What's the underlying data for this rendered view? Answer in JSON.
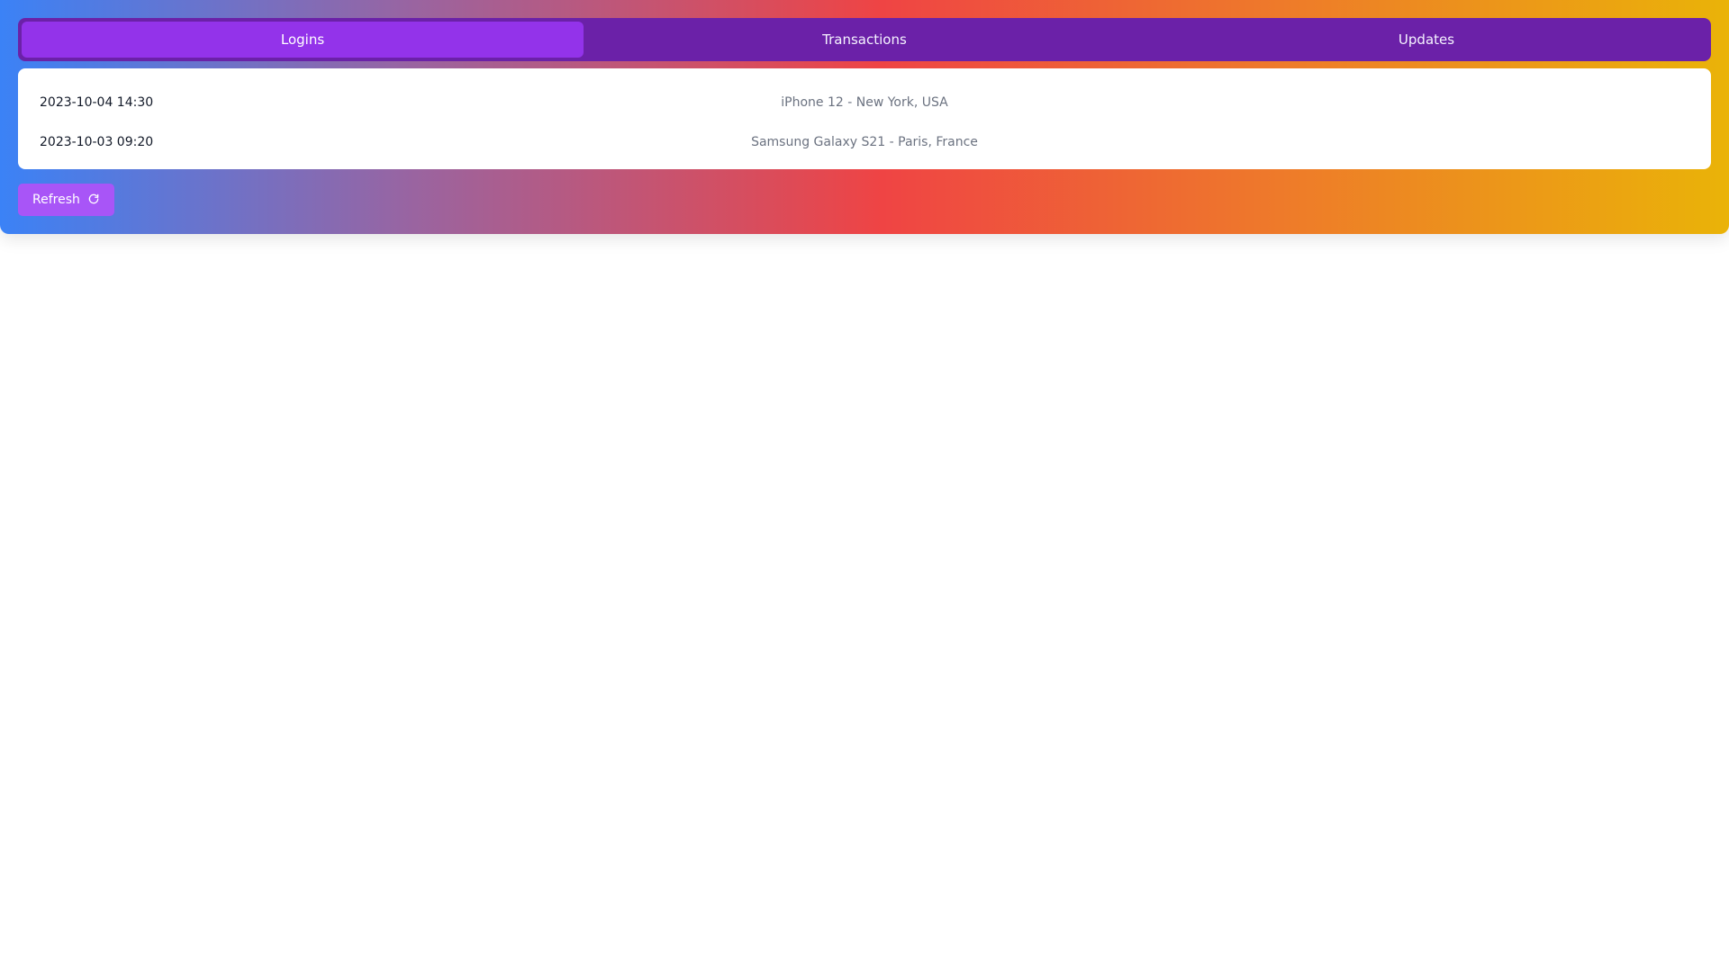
{
  "tabs": {
    "items": [
      {
        "label": "Logins",
        "active": true
      },
      {
        "label": "Transactions",
        "active": false
      },
      {
        "label": "Updates",
        "active": false
      }
    ]
  },
  "logins": [
    {
      "datetime": "2023-10-04 14:30",
      "device": "iPhone 12 - New York, USA"
    },
    {
      "datetime": "2023-10-03 09:20",
      "device": "Samsung Galaxy S21 - Paris, France"
    }
  ],
  "actions": {
    "refresh_label": "Refresh",
    "refresh_icon": "refresh-icon"
  },
  "colors": {
    "tab_bar": "#6b21a8",
    "tab_active": "#9333ea",
    "button": "#a855f7",
    "gradient": [
      "#3b82f6",
      "#ef4444",
      "#eab308"
    ]
  }
}
